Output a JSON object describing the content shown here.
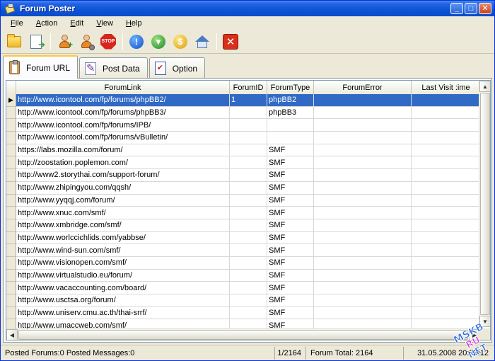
{
  "window": {
    "title": "Forum Poster"
  },
  "menu": [
    {
      "pre": "",
      "ul": "F",
      "post": "ile"
    },
    {
      "pre": "",
      "ul": "A",
      "post": "ction"
    },
    {
      "pre": "",
      "ul": "E",
      "post": "dit"
    },
    {
      "pre": "",
      "ul": "V",
      "post": "iew"
    },
    {
      "pre": "",
      "ul": "H",
      "post": "elp"
    }
  ],
  "toolbar": {
    "icons": [
      "open-folder-icon",
      "export-page-icon",
      "add-user-icon",
      "user-settings-icon",
      "stop-icon",
      "info-icon",
      "download-icon",
      "dollar-icon",
      "home-icon",
      "close-icon"
    ],
    "stop_label": "STOP"
  },
  "tabs": [
    {
      "label": "Forum URL",
      "icon": "clipboard-icon",
      "active": true
    },
    {
      "label": "Post Data",
      "icon": "edit-icon",
      "active": false
    },
    {
      "label": "Option",
      "icon": "checklist-icon",
      "active": false
    }
  ],
  "grid": {
    "columns": [
      "ForumLink",
      "ForumID",
      "ForumType",
      "ForumError",
      "Last Visit :ime"
    ],
    "rows": [
      [
        "http://www.icontool.com/fp/forums/phpBB2/",
        "1",
        "phpBB2",
        "",
        ""
      ],
      [
        "http://www.icontool.com/fp/forums/phpBB3/",
        "",
        "phpBB3",
        "",
        ""
      ],
      [
        "http://www.icontool.com/fp/forums/IPB/",
        "",
        "",
        "",
        ""
      ],
      [
        "http://www.icontool.com/fp/forums/vBulletin/",
        "",
        "",
        "",
        ""
      ],
      [
        "https://labs.mozilla.com/forum/",
        "",
        "SMF",
        "",
        ""
      ],
      [
        "http://zoostation.poplemon.com/",
        "",
        "SMF",
        "",
        ""
      ],
      [
        "http://www2.storythai.com/support-forum/",
        "",
        "SMF",
        "",
        ""
      ],
      [
        "http://www.zhipingyou.com/qqsh/",
        "",
        "SMF",
        "",
        ""
      ],
      [
        "http://www.yyqqj.com/forum/",
        "",
        "SMF",
        "",
        ""
      ],
      [
        "http://www.xnuc.com/smf/",
        "",
        "SMF",
        "",
        ""
      ],
      [
        "http://www.xmbridge.com/smf/",
        "",
        "SMF",
        "",
        ""
      ],
      [
        "http://www.worlccichlids.com/yabbse/",
        "",
        "SMF",
        "",
        ""
      ],
      [
        "http://www.wind-sun.com/smf/",
        "",
        "SMF",
        "",
        ""
      ],
      [
        "http://www.visionopen.com/smf/",
        "",
        "SMF",
        "",
        ""
      ],
      [
        "http://www.virtualstudio.eu/forum/",
        "",
        "SMF",
        "",
        ""
      ],
      [
        "http://www.vacaccounting.com/board/",
        "",
        "SMF",
        "",
        ""
      ],
      [
        "http://www.usctsa.org/forum/",
        "",
        "SMF",
        "",
        ""
      ],
      [
        "http://www.uniserv.cmu.ac.th/thai-srrf/",
        "",
        "SMF",
        "",
        ""
      ],
      [
        "http://www.umaccweb.com/smf/",
        "",
        "SMF",
        "",
        ""
      ]
    ],
    "selected_row": 0,
    "indicator": "▶"
  },
  "status": {
    "posted": "Posted Forums:0 Posted Messages:0",
    "position": "1/2164",
    "total": "Forum Total: 2164",
    "datetime": "31.05.2008 20:39:12"
  },
  "watermark": [
    "MSKB",
    "RU",
    "NET"
  ],
  "colors": {
    "selection": "#316ac5",
    "titlebar": "#0a53d8",
    "window_bg": "#ece9d8"
  }
}
